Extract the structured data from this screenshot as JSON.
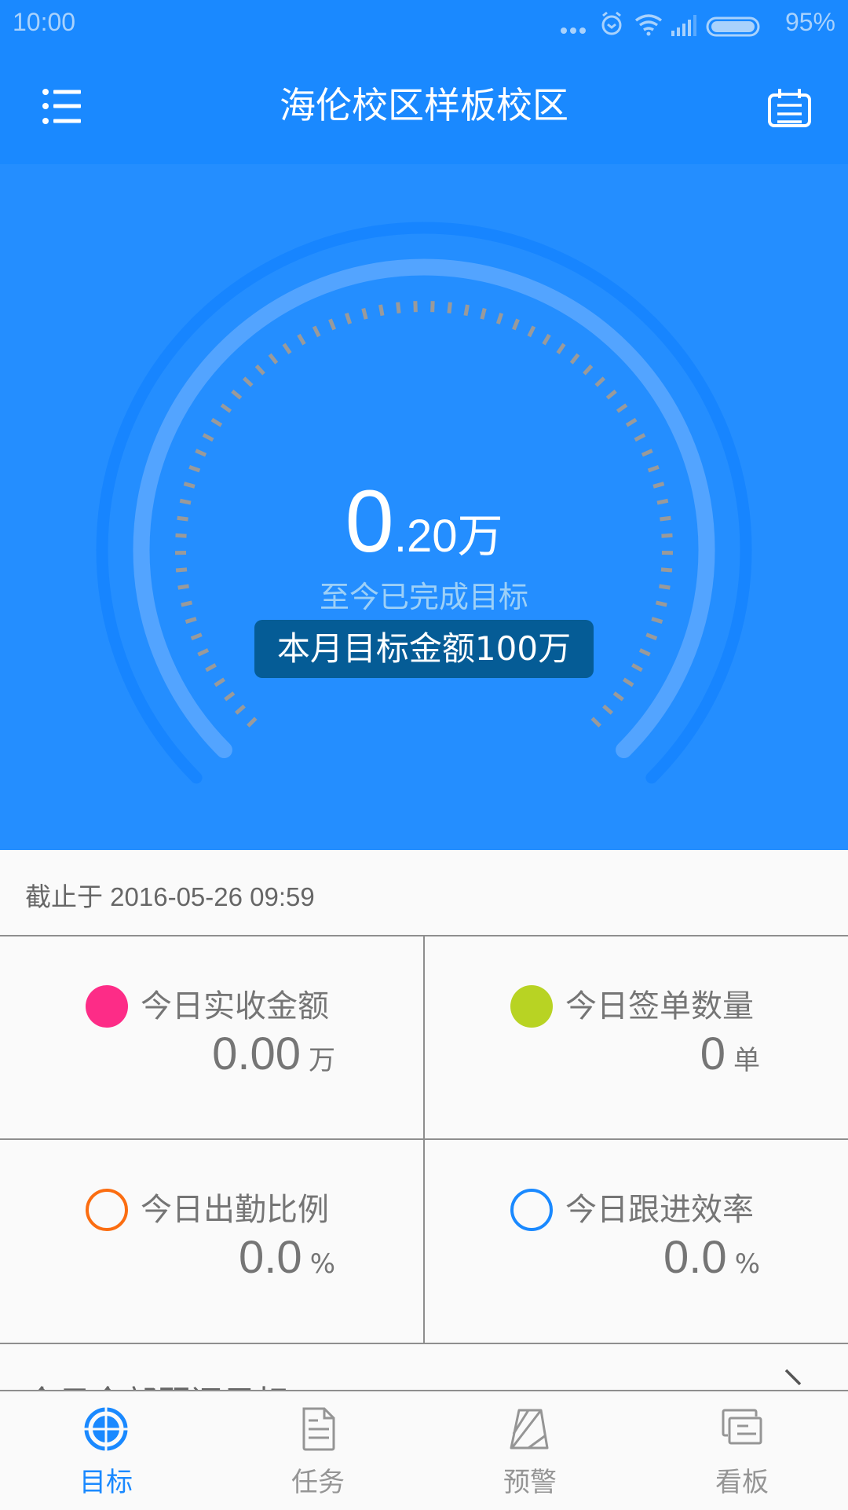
{
  "status_bar": {
    "time": "10:00",
    "battery_percent": "95%",
    "icons": [
      "more-dots-icon",
      "alarm-icon",
      "wifi-icon",
      "signal-icon",
      "battery-icon"
    ]
  },
  "header": {
    "title": "海伦校区样板校区",
    "left_icon": "menu-list-icon",
    "right_icon": "calendar-icon"
  },
  "gauge": {
    "value_integer": "0",
    "value_fraction": ".20万",
    "subtitle": "至今已完成目标",
    "target_label": "本月目标金额100万",
    "achieved_wan": 0.2,
    "target_wan": 100,
    "progress_fraction": 0.002
  },
  "as_of": {
    "text": "截止于 2016-05-26 09:59"
  },
  "stats": [
    {
      "label": "今日实收金额",
      "value": "0.00",
      "unit": "万",
      "color": "#fd2c87",
      "style": "filled"
    },
    {
      "label": "今日签单数量",
      "value": "0",
      "unit": "单",
      "color": "#b8d323",
      "style": "filled"
    },
    {
      "label": "今日出勤比例",
      "value": "0.0",
      "unit": "%",
      "color": "#fb6d11",
      "style": "outline"
    },
    {
      "label": "今日跟进效率",
      "value": "0.0",
      "unit": "%",
      "color": "#1a89ff",
      "style": "outline"
    }
  ],
  "more_row": {
    "label": "今日全部顾问目标"
  },
  "nav": {
    "items": [
      {
        "label": "目标",
        "icon": "target-icon",
        "active": true
      },
      {
        "label": "任务",
        "icon": "document-icon",
        "active": false
      },
      {
        "label": "预警",
        "icon": "warning-stripes-icon",
        "active": false
      },
      {
        "label": "看板",
        "icon": "board-cards-icon",
        "active": false
      }
    ]
  },
  "colors": {
    "primary": "#1a89ff",
    "hero_bg": "#248eff",
    "badge_bg": "#055c96",
    "text_gray": "#757575"
  }
}
